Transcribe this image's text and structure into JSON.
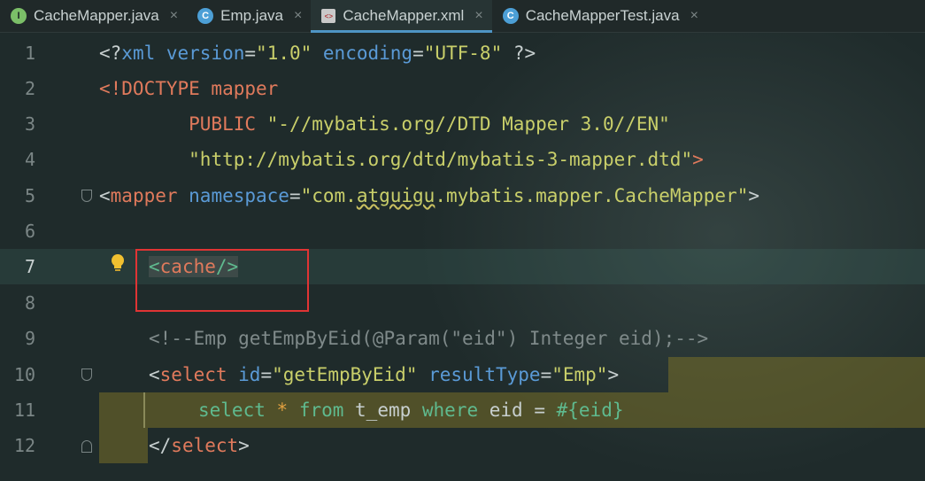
{
  "tabs": [
    {
      "label": "CacheMapper.java",
      "icon": "interface-icon",
      "glyph": "I"
    },
    {
      "label": "Emp.java",
      "icon": "class-icon",
      "glyph": "C"
    },
    {
      "label": "CacheMapper.xml",
      "icon": "xml-file-icon",
      "glyph": "<>"
    },
    {
      "label": "CacheMapperTest.java",
      "icon": "test-class-icon",
      "glyph": "C"
    }
  ],
  "close_glyph": "×",
  "line_numbers": [
    "1",
    "2",
    "3",
    "4",
    "5",
    "6",
    "7",
    "8",
    "9",
    "10",
    "11",
    "12"
  ],
  "code": {
    "l1": {
      "a": "<?",
      "b": "xml ",
      "c": "version",
      "d": "=",
      "e": "\"1.0\"",
      "f": " encoding",
      "g": "=",
      "h": "\"UTF-8\"",
      "i": " ?>"
    },
    "l2": {
      "a": "<!DOCTYPE mapper"
    },
    "l3": {
      "a": "        PUBLIC ",
      "b": "\"-//mybatis.org//DTD Mapper 3.0//EN\""
    },
    "l4": {
      "a": "        ",
      "b": "\"http://mybatis.org/dtd/mybatis-3-mapper.dtd\"",
      "c": ">"
    },
    "l5": {
      "a": "<",
      "b": "mapper",
      "c": " namespace",
      "d": "=",
      "e": "\"com.",
      "f": "atguigu",
      "g": ".mybatis.mapper.CacheMapper\"",
      "h": ">"
    },
    "l7": {
      "a": "<",
      "b": "cache",
      "c": "/>"
    },
    "l9": {
      "a": "<!--Emp getEmpByEid(@Param(\"eid\") Integer eid);-->"
    },
    "l10": {
      "a": "<",
      "b": "select",
      "c": " id",
      "d": "=",
      "e": "\"getEmpByEid\"",
      "f": " resultType",
      "g": "=",
      "h": "\"Emp\"",
      "i": ">"
    },
    "l11": {
      "a": "select ",
      "b": "* ",
      "c": "from ",
      "d": "t_emp ",
      "e": "where ",
      "f": "eid ",
      "g": "= ",
      "h": "#{eid}"
    },
    "l12": {
      "a": "</",
      "b": "select",
      "c": ">"
    }
  },
  "colors": {
    "accent": "#4e94c4",
    "highlight_box": "#e03434",
    "tag": "#e07a5c",
    "attr": "#5a9ad6",
    "string": "#c9cf6a"
  }
}
